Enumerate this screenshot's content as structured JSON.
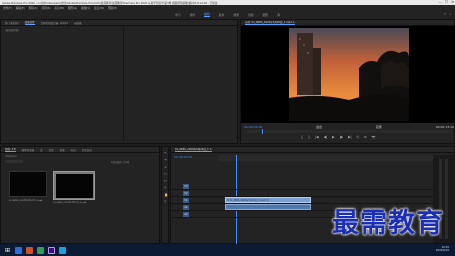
{
  "window": {
    "title": "Adobe Premiere Pro 2020 - C:\\用户\\Alienware\\文档\\Adobe\\Premiere Pro\\14.0\\\\最需教育\\最需教育\\Premiere Pro 2020 从新手到高手\\第3章 视频剪辑基础\\素材\\3.8.14.00 - 已更改",
    "minimize": "—",
    "maximize": "☐",
    "close": "✕"
  },
  "menu": [
    "文件(F)",
    "编辑(E)",
    "剪辑(C)",
    "序列(S)",
    "标记(M)",
    "图形(G)",
    "视图(V)",
    "窗口(W)",
    "帮助(H)"
  ],
  "workspaces": [
    "学习",
    "组件",
    "编辑",
    "颜色",
    "效果",
    "音频",
    "图形",
    "库"
  ],
  "workspaceActive": "编辑",
  "sourcePanel": {
    "tabs": [
      "源: (无剪辑)",
      "效果控件",
      "音频剪辑混合器: 序列01",
      "元数据"
    ],
    "activeTab": "效果控件",
    "empty_label": "(未选择剪辑)"
  },
  "programPanel": {
    "tab": "节目: 01_8KRS_2020年5月20日_1.mp4 ≡",
    "timecode_in": "00:00:02:00",
    "timecode_out": "00:00:13:10",
    "zoom": "适合",
    "quality": "完整",
    "controls": [
      "{",
      "}",
      "|◀",
      "◀|",
      "▶",
      "|▶",
      "▶|",
      "⎘",
      "⧉",
      "📷"
    ]
  },
  "projectPanel": {
    "tabs": [
      "项目: 3.8",
      "媒体浏览器",
      "库",
      "信息",
      "效果",
      "标记",
      "历史记录"
    ],
    "activeTab": "项目: 3.8",
    "path": "3.8.prproj",
    "item_count": "1项已选择, 共2项",
    "items": [
      {
        "name": "01_8KRS_2020年5月20日_1.mp4",
        "duration": "13:10"
      },
      {
        "name": "01_8KRS_2020年5月20日_1.mp4",
        "duration": "13:10"
      }
    ]
  },
  "timelinePanel": {
    "tab": "01_8KRS_2020年5月20日_1 ≡",
    "timecode": "00:00:02:00",
    "tracks": [
      "V3",
      "V2",
      "V1",
      "A1",
      "A2",
      "A3"
    ],
    "clipLabel": "fx 01_8KRS_2020年5月20日_1.mp4 [V]"
  },
  "watermark": "最需教育",
  "colors": {
    "accent": "#3d8dff",
    "clip_video": "#7a9fd1",
    "clip_audio": "#4f79ad",
    "watermark": "#1b2fb5",
    "taskbar": "#0c1a33"
  },
  "taskbar": {
    "time": "16:45",
    "date": "2020/6/10"
  }
}
